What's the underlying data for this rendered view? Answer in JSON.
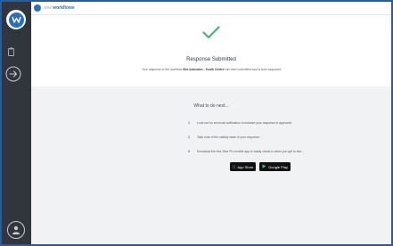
{
  "brand": {
    "prefix": "sine",
    "name": "workflows"
  },
  "submission": {
    "title": "Response Submitted",
    "message_prefix": "Your response to the workflow ",
    "workflow_name": "Site Induction - Youth Centre",
    "message_suffix": " has been submitted and is Auto Approved"
  },
  "next": {
    "title": "What to do next...",
    "steps": [
      {
        "num": "1",
        "text": "Look out for an email notification to indicate your response is approved."
      },
      {
        "num": "2",
        "text": "Take note of the validity state of your response."
      },
      {
        "num": "3",
        "text": "Download the free Sine Pro mobile app to easily check-in when you get to site..."
      }
    ]
  },
  "stores": {
    "apple": "App Store",
    "google": "Google Play"
  },
  "colors": {
    "sidebar": "#30363c",
    "accent": "#2c6fb5",
    "success": "#4caf78",
    "border": "#2e5a9a"
  },
  "icons": {
    "logo": "sine-logo-icon",
    "clipboard": "clipboard-icon",
    "signout": "sign-out-icon",
    "user": "user-icon",
    "check": "check-icon"
  }
}
